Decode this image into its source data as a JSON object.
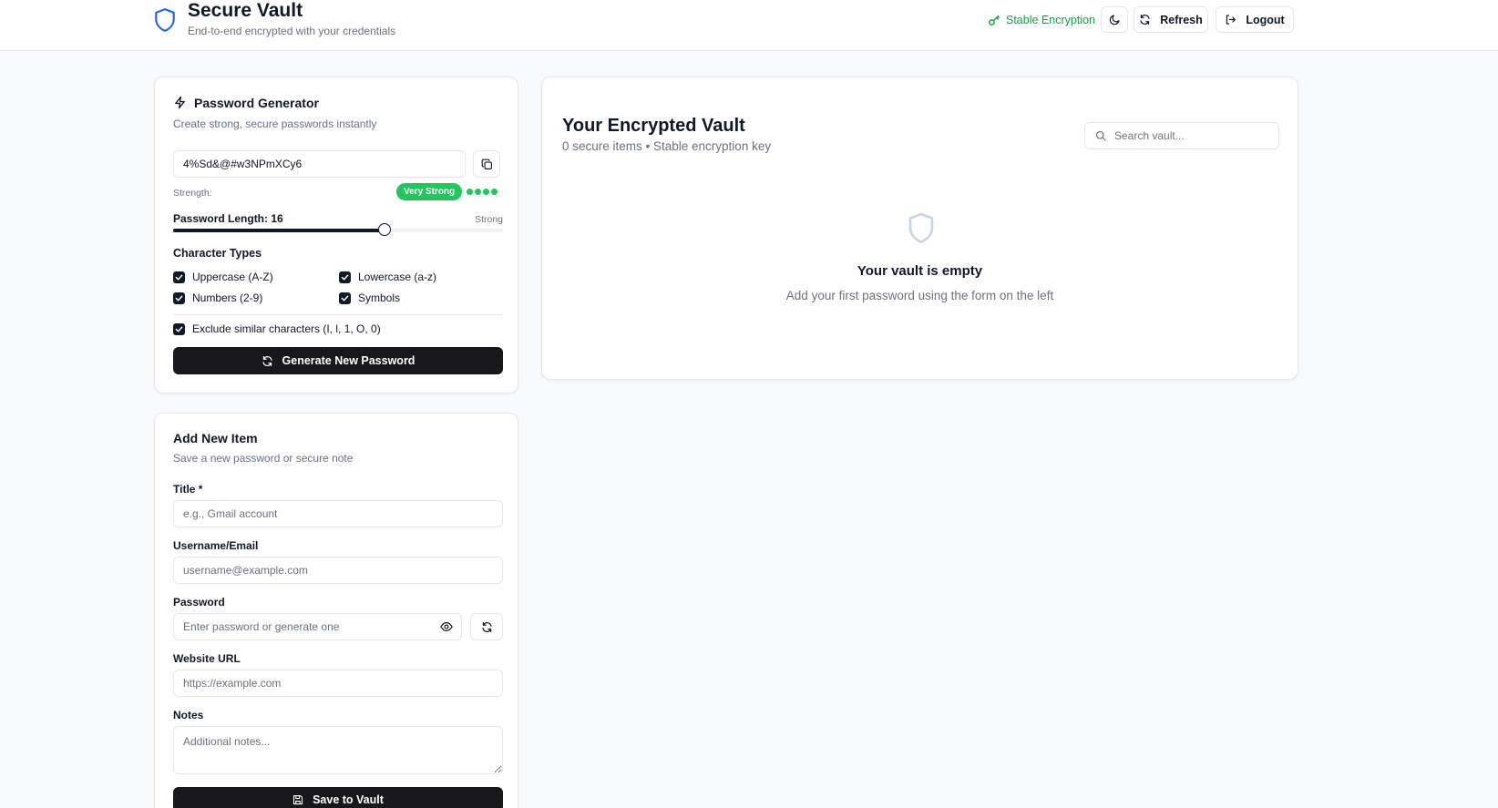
{
  "header": {
    "title": "Secure Vault",
    "subtitle": "End-to-end encrypted with your credentials",
    "encryption_status": "Stable Encryption",
    "refresh_label": "Refresh",
    "logout_label": "Logout"
  },
  "generator": {
    "title": "Password Generator",
    "subtitle": "Create strong, secure passwords instantly",
    "password_value": "4%Sd&@#w3NPmXCy6",
    "strength_label": "Strength:",
    "strength_badge": "Very Strong",
    "strength_level": 4,
    "strength_max": 4,
    "length_label": "Password Length: 16",
    "length_value": 16,
    "length_min": 4,
    "length_max": 64,
    "length_hint": "Strong",
    "char_types_title": "Character Types",
    "options": [
      {
        "label": "Uppercase (A-Z)",
        "checked": true
      },
      {
        "label": "Lowercase (a-z)",
        "checked": true
      },
      {
        "label": "Numbers (2-9)",
        "checked": true
      },
      {
        "label": "Symbols",
        "checked": true
      }
    ],
    "exclude_similar": "Exclude similar characters (I, l, 1, O, 0)",
    "generate_button": "Generate New Password"
  },
  "add_item": {
    "title": "Add New Item",
    "subtitle": "Save a new password or secure note",
    "title_label": "Title *",
    "title_placeholder": "e.g., Gmail account",
    "username_label": "Username/Email",
    "username_placeholder": "username@example.com",
    "password_label": "Password",
    "password_placeholder": "Enter password or generate one",
    "url_label": "Website URL",
    "url_placeholder": "https://example.com",
    "notes_label": "Notes",
    "notes_placeholder": "Additional notes...",
    "save_button": "Save to Vault"
  },
  "vault": {
    "title": "Your Encrypted Vault",
    "subtitle": "0 secure items • Stable encryption key",
    "search_placeholder": "Search vault...",
    "empty_title": "Your vault is empty",
    "empty_subtitle": "Add your first password using the form on the left"
  },
  "colors": {
    "accent_green": "#16a34a",
    "badge_green": "#22c55e",
    "brand_blue": "#2563eb",
    "dark_button": "#18181b"
  }
}
